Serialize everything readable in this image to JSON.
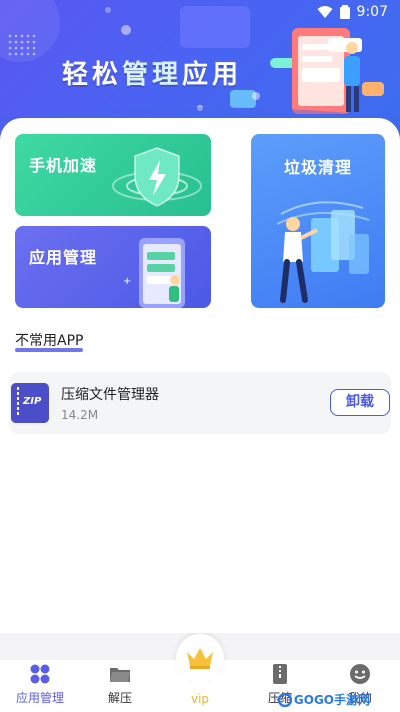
{
  "status": {
    "time": "9:07"
  },
  "banner": {
    "title_part1": "轻松",
    "title_part2": "管理",
    "title_part3": "应用"
  },
  "cards": {
    "speed": {
      "label": "手机加速"
    },
    "clean": {
      "label": "垃圾清理"
    },
    "manage": {
      "label": "应用管理"
    }
  },
  "section": {
    "title": "不常用APP"
  },
  "apps": [
    {
      "name": "压缩文件管理器",
      "size": "14.2M",
      "icon_text": "ZIP",
      "action": "卸载"
    }
  ],
  "tabs": [
    {
      "label": "应用管理",
      "icon": "grid-icon"
    },
    {
      "label": "解压",
      "icon": "folder-icon"
    },
    {
      "label": "vip",
      "icon": "crown-icon"
    },
    {
      "label": "压缩",
      "icon": "zip-file-icon"
    },
    {
      "label": "我的",
      "icon": "smile-icon"
    }
  ],
  "watermark": {
    "text": "GOGO手游网"
  },
  "colors": {
    "accent": "#5a5ee6",
    "green_card": "#2fcb97",
    "blue_card": "#4a86f6",
    "vip": "#e8b530"
  }
}
